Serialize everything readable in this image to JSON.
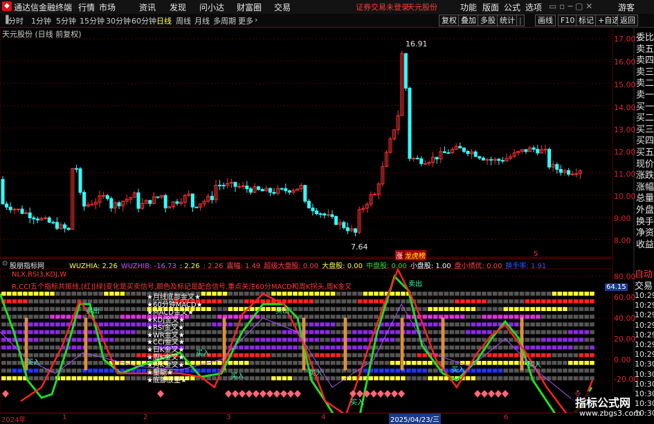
{
  "titlebar": {
    "app_title": "通达信金融终端",
    "menus": [
      "行情",
      "市场",
      "资讯",
      "发现",
      "问小达",
      "财富圈",
      "交易"
    ],
    "status": [
      "证券交易未登录",
      "天元股份"
    ],
    "right_items": [
      "功能",
      "版面",
      "公式",
      "选项"
    ],
    "guest": "游客"
  },
  "toolbar": {
    "periods": [
      "分时",
      "1分钟",
      "5分钟",
      "15分钟",
      "30分钟",
      "60分钟",
      "日线",
      "周线",
      "月线",
      "多周期",
      "更多"
    ],
    "active_period": "日线",
    "more_arrow": "›",
    "right_buttons": [
      "复权",
      "叠加",
      "多股",
      "统计",
      "画线",
      "F10",
      "标记",
      "+自选",
      "返回"
    ]
  },
  "main_chart": {
    "title": "天元股份 (日线 前复权)",
    "y_ticks": [
      "17.00",
      "16.00",
      "15.00",
      "14.00",
      "13.00",
      "12.00",
      "11.00",
      "10.00",
      "9.00",
      "8.00"
    ],
    "high_label": "16.91",
    "low_label": "7.64",
    "badge_rise": "涨",
    "badge_dragon": "龙虎榜",
    "badge_s": "S"
  },
  "right_panel": {
    "labels": [
      "委比",
      "卖五",
      "卖四",
      "卖三",
      "卖二",
      "卖一",
      "买一",
      "买二",
      "买三",
      "买四",
      "买五",
      "现价",
      "涨跌",
      "涨幅",
      "总量",
      "外盘",
      "换手",
      "净资",
      "收益"
    ],
    "auto_label": "自动",
    "trade_label": "交易",
    "times": [
      "10:29",
      "10:29",
      "10:29",
      "10:29",
      "10:29",
      "10:29",
      "10:29",
      "10:30",
      "10:30",
      "10:30",
      "10:30",
      "10:30",
      "10:30"
    ]
  },
  "indicator": {
    "name": "股朋指标网",
    "values": [
      {
        "label": "WUZHIA: 2.26",
        "color": "#ffff55"
      },
      {
        "label": "WUZHIB: -16.73",
        "color": "#cc55ff"
      },
      {
        "label": ": 2.26",
        "color": "#ffff55"
      },
      {
        "label": ": 2.26",
        "color": "#ff4444"
      },
      {
        "label": "震幅: 1.49",
        "color": "#ff4444"
      },
      {
        "label": "超级大盘股: 0.00",
        "color": "#ff4444"
      },
      {
        "label": "大盘股: 0.00",
        "color": "#ffff55"
      },
      {
        "label": "中盘股: 0.00",
        "color": "#33dd33"
      },
      {
        "label": "小盘股: 1.00",
        "color": "#ffffff"
      },
      {
        "label": "盘小绩优: 0.00",
        "color": "#ff4444"
      },
      {
        "label": "换手率: 1.91",
        "color": "#3355ff"
      }
    ],
    "note1": "NLX,RSI3,KDJ,W",
    "note2": "R,CCI五个指标共振线,[红][绿]变化是买卖信号,颜色及标记是配合信号,重点关注60分MACD和周K拐头,周K金叉",
    "y_ticks": [
      "80.00",
      "60.00",
      "40.00",
      "20.00",
      "0.00",
      "-20.00"
    ],
    "current_value": "64.15",
    "row_labels": [
      "月线底部金叉",
      "60分钟MACD",
      "MACD金叉",
      "KDJ金叉",
      "RSI金叉",
      "WR金叉",
      "CCI金叉",
      "日K金叉",
      "周K金叉",
      "月K金叉",
      "量能",
      "底部放量"
    ],
    "signals": [
      {
        "text": "买入",
        "color": "#33ffaa"
      },
      {
        "text": "卖出",
        "color": "#33ffaa"
      },
      {
        "text": "买入",
        "color": "#33ffaa"
      },
      {
        "text": "买入",
        "color": "#33ffaa"
      },
      {
        "text": "卖出",
        "color": "#33ffaa"
      },
      {
        "text": "买入",
        "color": "#33ffaa"
      },
      {
        "text": "买入",
        "color": "#33ffaa"
      },
      {
        "text": "卖出",
        "color": "#33ffaa"
      },
      {
        "text": "买入",
        "color": "#33ffaa"
      },
      {
        "text": "买入",
        "color": "#33ffaa"
      }
    ]
  },
  "x_axis": {
    "labels": [
      "2024年",
      "1",
      "2",
      "3",
      "4",
      "2025/04/23/三",
      "6"
    ]
  },
  "watermark": {
    "line1": "指标公式网",
    "line2": "www.zbgs3.com"
  },
  "colors": {
    "up": "#ff3333",
    "down": "#33ffff",
    "yellow": "#ffff33",
    "red": "#ff2222",
    "magenta": "#dd33dd",
    "purple": "#8a2be2",
    "blue": "#2233ff",
    "grey": "#555555"
  }
}
